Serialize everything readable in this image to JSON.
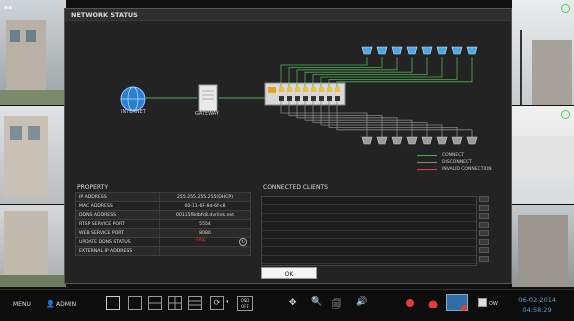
{
  "dialog": {
    "title": "NETWORK STATUS",
    "nodes": {
      "internet": "INTERNET",
      "gateway": "GATEWAY"
    },
    "legend": [
      {
        "label": "CONNECT",
        "color": "#4caf50"
      },
      {
        "label": "DISCONNECT",
        "color": "#888888"
      },
      {
        "label": "INVALID CONNECTION",
        "color": "#e53935"
      }
    ],
    "property_title": "PROPERTY",
    "properties": [
      {
        "name": "IP ADDRESS",
        "value": "255.255.255.255(DHCP)"
      },
      {
        "name": "MAC ADDRESS",
        "value": "00-11-6F-8d-6f-c8"
      },
      {
        "name": "DDNS ADDRESS",
        "value": "00115f8dbfc8.dvrlink.net"
      },
      {
        "name": "RTSP SERVICE PORT",
        "value": "5554"
      },
      {
        "name": "WEB SERVICE PORT",
        "value": "8080"
      },
      {
        "name": "UPDATE DDNS STATUS",
        "value": "FAIL"
      },
      {
        "name": "EXTERNAL IP ADDRESS",
        "value": ""
      }
    ],
    "clients_title": "CONNECTED CLIENTS",
    "ok_label": "OK"
  },
  "taskbar": {
    "menu_label": "MENU",
    "user_label": "ADMIN",
    "osd_label": "OSD OFF",
    "ow_label": "OW",
    "date": "06-02-2014",
    "time": "04:58:29"
  },
  "colors": {
    "connect": "#4caf50",
    "disconnect": "#888888",
    "invalid": "#e53935",
    "date_text": "#6699cc"
  }
}
